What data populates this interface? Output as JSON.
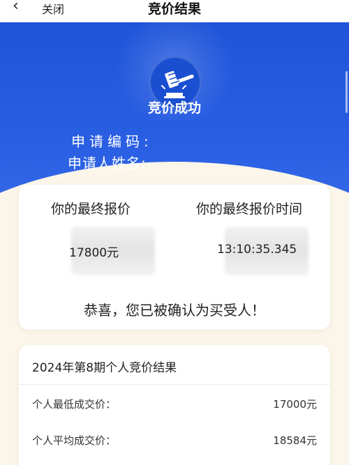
{
  "nav": {
    "back_glyph": "‹",
    "close_label": "关闭",
    "title": "竞价结果"
  },
  "hero": {
    "badge_icon": "gavel-icon",
    "title": "竞价成功",
    "apply_code_label": "申请编码:",
    "applicant_label": "申请人姓名:"
  },
  "result_card": {
    "price_label": "你的最终报价",
    "time_label": "你的最终报价时间",
    "price_value": "17800元",
    "time_value": "13:10:35.345",
    "congrats_text": "恭喜，您已被确认为买受人！"
  },
  "summary_card": {
    "title": "2024年第8期个人竞价结果",
    "rows": [
      {
        "label": "个人最低成交价：",
        "value": "17000元"
      },
      {
        "label": "个人平均成交价：",
        "value": "18584元"
      }
    ]
  },
  "colors": {
    "brand_blue": "#1f54d9",
    "background": "#fbf6e9",
    "card": "#ffffff"
  }
}
